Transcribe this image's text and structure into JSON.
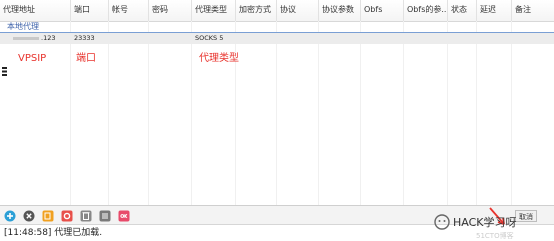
{
  "columns": [
    "代理地址",
    "端口",
    "帐号",
    "密码",
    "代理类型",
    "加密方式",
    "协议",
    "协议参数",
    "Obfs",
    "Obfs的参...",
    "状态",
    "延迟",
    "备注"
  ],
  "group": {
    "label": "本地代理"
  },
  "row": {
    "address_suffix": ".123",
    "port": "23333",
    "proxy_type": "SOCKS 5"
  },
  "annotations": {
    "vps_ip": "VPSIP",
    "port": "端口",
    "proxy_type": "代理类型"
  },
  "toolbar": {
    "buttons": [
      {
        "icon": "plus-icon",
        "color": "#2a9fd6"
      },
      {
        "icon": "close-icon",
        "color": "#555555"
      },
      {
        "icon": "copy-icon",
        "color": "#f0a020"
      },
      {
        "icon": "gear-icon",
        "color": "#e8504a"
      },
      {
        "icon": "trash-icon",
        "color": "#888888"
      },
      {
        "icon": "list-icon",
        "color": "#7a7a7a"
      },
      {
        "icon": "ok-icon",
        "color": "#e84a6a"
      }
    ],
    "cancel_label": "取消"
  },
  "status": {
    "text": "[11:48:58]  代理已加载."
  },
  "watermark": {
    "text": "HACK学习呀",
    "subtext": "51CTO博客"
  },
  "colors": {
    "annotation": "#e8332d",
    "group_line": "#7a9fd4",
    "row_bg": "#ececec"
  }
}
